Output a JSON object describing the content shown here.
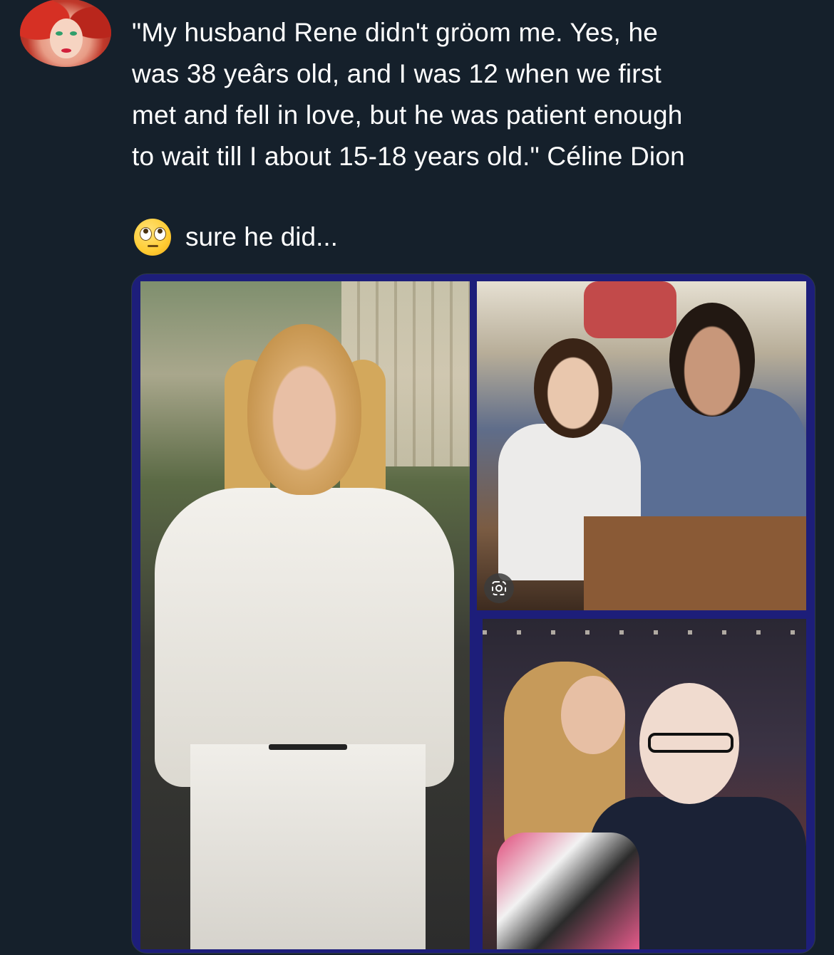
{
  "post": {
    "text": "\"My husband Rene didn't gröom me. Yes, he\nwas 38 yeârs old, and I was 12 when we first\nmet and fell in love, but he was patient enough\nto wait till I about 15-18 years old.\" Céline Dion",
    "reply_text": "sure he did...",
    "reply_emoji": "face-with-rolling-eyes-icon"
  },
  "media": {
    "border_color": "#1d1e7a",
    "images": [
      {
        "name": "photo-woman-white-blouse"
      },
      {
        "name": "photo-girl-and-man-at-table"
      },
      {
        "name": "photo-couple-embracing"
      }
    ],
    "lens_icon": "lens-search-icon"
  },
  "colors": {
    "background": "#15202b",
    "text": "#ffffff"
  }
}
